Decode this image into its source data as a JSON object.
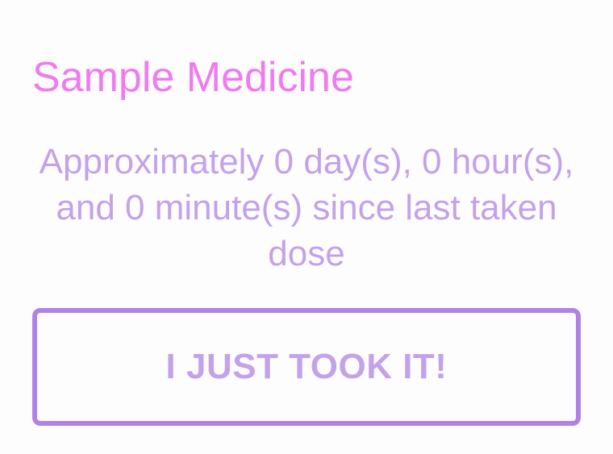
{
  "medicine": {
    "name": "Sample Medicine",
    "elapsed_text": "Approximately 0 day(s), 0 hour(s), and 0 minute(s) since last taken dose",
    "took_button_label": "I JUST TOOK IT!"
  },
  "colors": {
    "title": "#f07af0",
    "body_text": "#c3a2ea",
    "button_border": "#b182e6",
    "background": "#fefdfe"
  }
}
